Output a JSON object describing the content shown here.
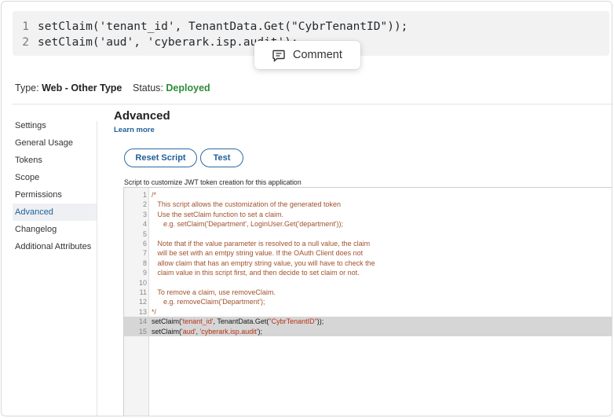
{
  "snippet": {
    "lines": [
      {
        "num": "1",
        "text": "setClaim('tenant_id', TenantData.Get(\"CybrTenantID\"));"
      },
      {
        "num": "2",
        "text": "setClaim('aud', 'cyberark.isp.audit');"
      }
    ]
  },
  "comment_popup": {
    "label": "Comment",
    "icon": "comment-icon"
  },
  "meta": {
    "type_label": "Type:",
    "type_value": "Web - Other Type",
    "status_label": "Status:",
    "status_value": "Deployed",
    "status_color": "#2e8b3a"
  },
  "sidebar": {
    "items": [
      {
        "label": "Settings"
      },
      {
        "label": "General Usage"
      },
      {
        "label": "Tokens"
      },
      {
        "label": "Scope"
      },
      {
        "label": "Permissions"
      },
      {
        "label": "Advanced",
        "active": true
      },
      {
        "label": "Changelog"
      },
      {
        "label": "Additional Attributes"
      }
    ]
  },
  "main": {
    "title": "Advanced",
    "learn_more": "Learn more",
    "reset_button": "Reset Script",
    "test_button": "Test",
    "editor_label": "Script to customize JWT token creation for this application"
  },
  "editor": {
    "lines": [
      {
        "num": "1",
        "parts": [
          {
            "t": "/*",
            "c": "cmt"
          }
        ]
      },
      {
        "num": "2",
        "parts": [
          {
            "t": "   This script allows the customization of the generated token",
            "c": "cmt"
          }
        ]
      },
      {
        "num": "3",
        "parts": [
          {
            "t": "   Use the setClaim function to set a claim.",
            "c": "cmt"
          }
        ]
      },
      {
        "num": "4",
        "parts": [
          {
            "t": "      e.g. setClaim('Department', LoginUser.Get('department'));",
            "c": "cmt"
          }
        ]
      },
      {
        "num": "5",
        "parts": [
          {
            "t": "",
            "c": "cmt"
          }
        ]
      },
      {
        "num": "6",
        "parts": [
          {
            "t": "   Note that if the value parameter is resolved to a null value, the claim",
            "c": "cmt"
          }
        ]
      },
      {
        "num": "7",
        "parts": [
          {
            "t": "   will be set with an emtpy string value. If the OAuth Client does not",
            "c": "cmt"
          }
        ]
      },
      {
        "num": "8",
        "parts": [
          {
            "t": "   allow claim that has an emptry string value, you will have to check the",
            "c": "cmt"
          }
        ]
      },
      {
        "num": "9",
        "parts": [
          {
            "t": "   claim value in this script first, and then decide to set claim or not.",
            "c": "cmt"
          }
        ]
      },
      {
        "num": "10",
        "parts": [
          {
            "t": "",
            "c": "cmt"
          }
        ]
      },
      {
        "num": "11",
        "parts": [
          {
            "t": "   To remove a claim, use removeClaim.",
            "c": "cmt"
          }
        ]
      },
      {
        "num": "12",
        "parts": [
          {
            "t": "      e.g. removeClaim('Department');",
            "c": "cmt"
          }
        ]
      },
      {
        "num": "13",
        "parts": [
          {
            "t": "*/",
            "c": "cmt"
          }
        ]
      },
      {
        "num": "14",
        "selected": true,
        "parts": [
          {
            "t": "setClaim(",
            "c": "plain"
          },
          {
            "t": "'tenant_id'",
            "c": "str"
          },
          {
            "t": ", TenantData.Get(",
            "c": "plain"
          },
          {
            "t": "\"CybrTenantID\"",
            "c": "str"
          },
          {
            "t": "));",
            "c": "plain"
          }
        ]
      },
      {
        "num": "15",
        "selected": true,
        "parts": [
          {
            "t": "setClaim(",
            "c": "plain"
          },
          {
            "t": "'aud'",
            "c": "str"
          },
          {
            "t": ", ",
            "c": "plain"
          },
          {
            "t": "'cyberark.isp.audit'",
            "c": "str"
          },
          {
            "t": ");",
            "c": "plain"
          }
        ]
      }
    ]
  }
}
